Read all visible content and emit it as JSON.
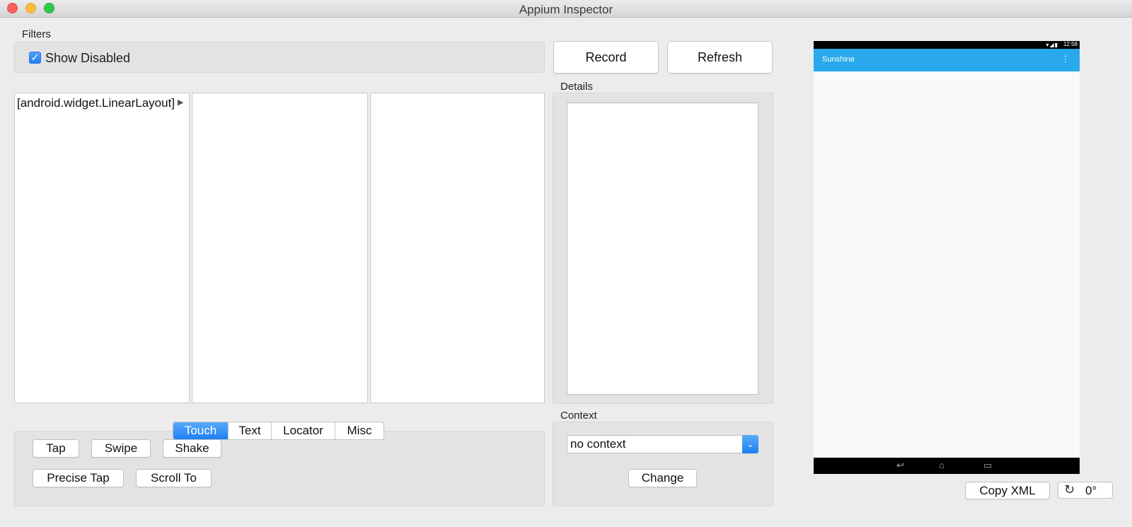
{
  "window": {
    "title": "Appium Inspector"
  },
  "filters": {
    "label": "Filters",
    "show_disabled_label": "Show Disabled",
    "show_disabled_checked": true
  },
  "toolbar": {
    "record_label": "Record",
    "refresh_label": "Refresh"
  },
  "browser": {
    "columns": [
      {
        "items": [
          "[android.widget.LinearLayout]"
        ]
      },
      {
        "items": []
      },
      {
        "items": []
      }
    ]
  },
  "details": {
    "label": "Details"
  },
  "actions": {
    "tabs": [
      {
        "label": "Touch",
        "active": true
      },
      {
        "label": "Text",
        "active": false
      },
      {
        "label": "Locator",
        "active": false
      },
      {
        "label": "Misc",
        "active": false
      }
    ],
    "buttons": {
      "tap": "Tap",
      "swipe": "Swipe",
      "shake": "Shake",
      "precise_tap": "Precise Tap",
      "scroll_to": "Scroll To"
    }
  },
  "context": {
    "label": "Context",
    "selected": "no context",
    "change_label": "Change"
  },
  "device": {
    "status_time": "12:58",
    "app_title": "Sunshine",
    "overflow_icon": "vertical-dots-icon",
    "nav_icons": [
      "back-icon",
      "home-icon",
      "recents-icon"
    ]
  },
  "bottom": {
    "copy_xml_label": "Copy XML",
    "rotation_label": "0°"
  },
  "colors": {
    "accent": "#1f7ff2",
    "app_bar": "#29a8ec",
    "close": "#fc605c",
    "minimize": "#fdbc40",
    "maximize": "#34c84a"
  }
}
